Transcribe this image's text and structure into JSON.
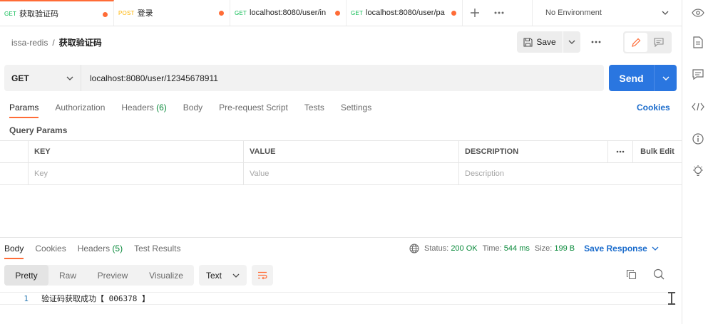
{
  "tabs": [
    {
      "method": "GET",
      "title": "获取验证码",
      "active": true
    },
    {
      "method": "POST",
      "title": "登录",
      "active": false
    },
    {
      "method": "GET",
      "title": "localhost:8080/user/in",
      "active": false
    },
    {
      "method": "GET",
      "title": "localhost:8080/user/pa",
      "active": false
    }
  ],
  "environment": "No Environment",
  "breadcrumb": {
    "parent": "issa-redis",
    "separator": "/",
    "current": "获取验证码"
  },
  "toolbar": {
    "save_label": "Save"
  },
  "request": {
    "method": "GET",
    "url": "localhost:8080/user/12345678911",
    "send_label": "Send"
  },
  "request_tabs": {
    "params": "Params",
    "authorization": "Authorization",
    "headers": "Headers",
    "headers_count": "(6)",
    "body": "Body",
    "prerequest": "Pre-request Script",
    "tests": "Tests",
    "settings": "Settings",
    "cookies": "Cookies"
  },
  "query_params": {
    "title": "Query Params",
    "headers": {
      "key": "KEY",
      "value": "VALUE",
      "description": "DESCRIPTION",
      "bulk_edit": "Bulk Edit"
    },
    "placeholders": {
      "key": "Key",
      "value": "Value",
      "description": "Description"
    }
  },
  "response": {
    "tabs": {
      "body": "Body",
      "cookies": "Cookies",
      "headers": "Headers",
      "headers_count": "(5)",
      "test_results": "Test Results"
    },
    "status_label": "Status:",
    "status_value": "200 OK",
    "time_label": "Time:",
    "time_value": "544 ms",
    "size_label": "Size:",
    "size_value": "199 B",
    "save_response": "Save Response",
    "formats": [
      "Pretty",
      "Raw",
      "Preview",
      "Visualize"
    ],
    "type": "Text",
    "lines": [
      {
        "n": "1",
        "text": "验证码获取成功【 006378 】"
      }
    ]
  },
  "colors": {
    "accent": "#ff6c37",
    "send": "#2a76e0",
    "link": "#1b6ccc",
    "success": "#0a8a3b"
  }
}
